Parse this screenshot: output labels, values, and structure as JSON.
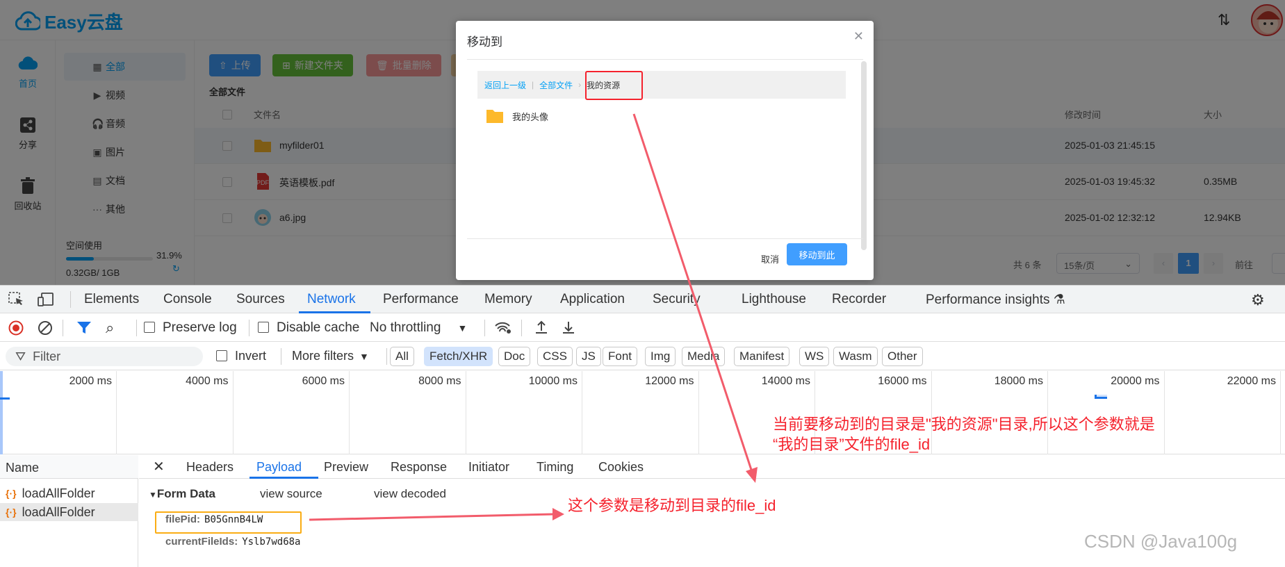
{
  "app": {
    "logo_text": "Easy云盘",
    "left_nav": [
      {
        "label": "首页",
        "icon": "cloud-icon"
      },
      {
        "label": "分享",
        "icon": "share-icon"
      },
      {
        "label": "回收站",
        "icon": "trash-icon"
      }
    ],
    "categories": [
      {
        "label": "全部",
        "icon": "grid-icon"
      },
      {
        "label": "视频",
        "icon": "play-icon"
      },
      {
        "label": "音频",
        "icon": "headphones-icon"
      },
      {
        "label": "图片",
        "icon": "image-icon"
      },
      {
        "label": "文档",
        "icon": "word-doc-icon"
      },
      {
        "label": "其他",
        "icon": "more-icon"
      }
    ],
    "storage": {
      "label": "空间使用",
      "percent": "31.9%",
      "used": "0.32GB/ 1GB",
      "fraction": 0.319
    },
    "toolbar": {
      "upload": "上传",
      "new_folder": "新建文件夹",
      "batch_delete": "批量删除"
    },
    "breadcrumb": "全部文件",
    "columns": {
      "name": "文件名",
      "modified": "修改时间",
      "size": "大小"
    },
    "files": [
      {
        "name": "myfilder01",
        "time": "2025-01-03 21:45:15",
        "size": "",
        "type": "folder"
      },
      {
        "name": "英语模板.pdf",
        "time": "2025-01-03 19:45:32",
        "size": "0.35MB",
        "type": "pdf"
      },
      {
        "name": "a6.jpg",
        "time": "2025-01-02 12:32:12",
        "size": "12.94KB",
        "type": "image"
      }
    ],
    "pager": {
      "total": "共 6 条",
      "page_size": "15条/页",
      "current": "1",
      "goto": "前往"
    }
  },
  "dialog": {
    "title": "移动到",
    "nav": {
      "back": "返回上一级",
      "all": "全部文件",
      "current": "我的资源"
    },
    "folder": "我的头像",
    "cancel": "取消",
    "confirm": "移动到此"
  },
  "devtools": {
    "tabs": [
      "Elements",
      "Console",
      "Sources",
      "Network",
      "Performance",
      "Memory",
      "Application",
      "Security",
      "Lighthouse",
      "Recorder",
      "Performance insights"
    ],
    "active_tab": "Network",
    "toolbar": {
      "preserve_log": "Preserve log",
      "disable_cache": "Disable cache",
      "throttling": "No throttling"
    },
    "filter": {
      "placeholder": "Filter",
      "invert": "Invert",
      "more_filters": "More filters"
    },
    "types": [
      "All",
      "Fetch/XHR",
      "Doc",
      "CSS",
      "JS",
      "Font",
      "Img",
      "Media",
      "Manifest",
      "WS",
      "Wasm",
      "Other"
    ],
    "active_type": "Fetch/XHR",
    "timeline_labels": [
      "2000 ms",
      "4000 ms",
      "6000 ms",
      "8000 ms",
      "10000 ms",
      "12000 ms",
      "14000 ms",
      "16000 ms",
      "18000 ms",
      "20000 ms",
      "22000 ms"
    ],
    "name_header": "Name",
    "requests": [
      "loadAllFolder",
      "loadAllFolder"
    ],
    "detail_tabs": [
      "Headers",
      "Payload",
      "Preview",
      "Response",
      "Initiator",
      "Timing",
      "Cookies"
    ],
    "active_detail": "Payload",
    "form_data": {
      "title": "Form Data",
      "view_source": "view source",
      "view_decoded": "view decoded",
      "fields": [
        {
          "key": "filePid:",
          "value": "B05GnnB4LW"
        },
        {
          "key": "currentFileIds:",
          "value": "Yslb7wd68a"
        }
      ]
    }
  },
  "annotations": {
    "top_line1": "当前要移动到的目录是\"我的资源\"目录,所以这个参数就是",
    "top_line2": "“我的目录”文件的file_id",
    "bottom": "这个参数是移动到目录的file_id",
    "color": "#f5222d"
  },
  "watermark": "CSDN @Java100g"
}
